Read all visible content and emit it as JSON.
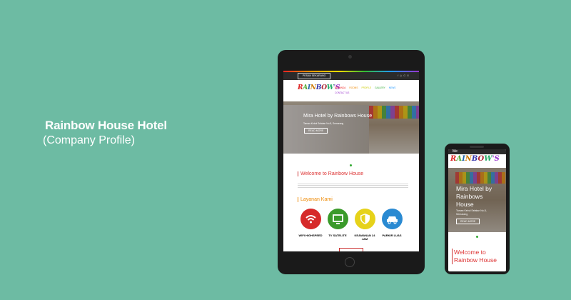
{
  "heading": {
    "title": "Rainbow House Hotel",
    "subtitle": "(Company Profile)"
  },
  "site": {
    "book_button": "PESAN SEKARANG",
    "social_icons": [
      "facebook-icon",
      "instagram-icon",
      "googleplus-icon",
      "phone-icon"
    ],
    "logo_text": "RAINBOW'S",
    "nav": [
      "BERANDA",
      "ROOMS",
      "PROFILE",
      "GALLERY",
      "NEWS",
      "CONTACT US"
    ],
    "nav_colors": [
      "#e22",
      "#e80",
      "#cc0",
      "#3a3",
      "#29f",
      "#93c"
    ],
    "hero": {
      "title": "Mira Hotel by Rainbows House",
      "subtitle": "Taman Kebul Selatan No.8, Semarang",
      "button": "READ MORE"
    },
    "welcome": "Welcome to Rainbow House",
    "services_title": "Layanan Kami",
    "services": [
      {
        "label": "WIFI HIGHSPEED",
        "icon": "wifi-icon",
        "color": "#d62a2a"
      },
      {
        "label": "TV SATELITE",
        "icon": "tv-icon",
        "color": "#3a9a2a"
      },
      {
        "label": "KEAMANAN 24 JAM",
        "icon": "shield-icon",
        "color": "#e6d21a"
      },
      {
        "label": "PARKIR LUAS",
        "icon": "car-icon",
        "color": "#2a8ad2"
      }
    ]
  },
  "phone": {
    "menu_label": "Me",
    "hero_title": "Mira Hotel by Rainbows House",
    "hero_sub": "Taman Kebul Selatan No.8, Semarang",
    "hero_button": "READ MORE",
    "welcome": "Welcome to Rainbow House"
  }
}
